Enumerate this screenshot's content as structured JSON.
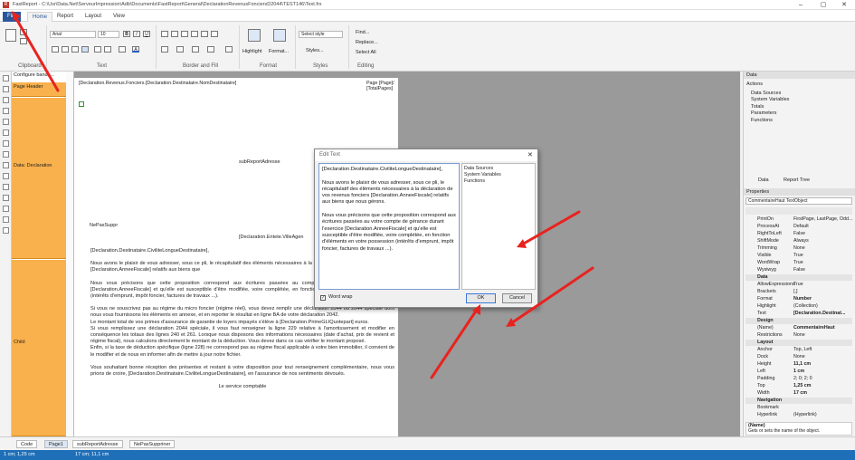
{
  "window": {
    "title": "FastReport - C:\\Usr\\Data.Net\\ServeurImpression\\Adb\\Documents\\FastReport\\General\\DeclarationRevenusFonciersD2044\\TEST146\\Text.frx"
  },
  "menu": {
    "file": "File",
    "home": "Home",
    "report": "Report",
    "layout": "Layout",
    "view": "View"
  },
  "ribbon": {
    "font_name": "Arial",
    "font_size": "10",
    "style_value": "Select style",
    "groups": {
      "clipboard": "Clipboard",
      "text": "Text",
      "border": "Border and Fill",
      "format": "Format",
      "styles": "Styles",
      "editing": "Editing"
    },
    "highlight": "Highlight",
    "format_btn": "Format...",
    "styles_btn": "Styles...",
    "find": "Find...",
    "replace": "Replace...",
    "select_all": "Select All"
  },
  "tools": {
    "configure_bands": "Configure bands..."
  },
  "bands": {
    "page_header": "Page Header",
    "data": "Data: Declaration",
    "child": "Child"
  },
  "page": {
    "header_field": "[Declaration.Revenus.Fonciers.[Declaration.Destinataire.NomDestinataire]",
    "page_field": "Page [Page]/\n[TotalPages]",
    "subreport": "subReportAdresse",
    "entete": "[Declaration.Entete.VilleAgen",
    "nepas": "NePasSuppr",
    "para1": "[Declaration.Destinataire.CiviliteLongueDestinataire],",
    "para2": "Nous avons le plaisir de vous adresser, sous ce pli, le récapitulatif des éléments nécessaires à la déclaration de vos revenus fonciers [Declaration.AnneeFiscale] relatifs aux biens que",
    "para3": "Nous vous précisons que cette proposition correspond aux écritures passées au compte de gérance durant l'exercice [Declaration.AnneeFiscale] et qu'elle est susceptible d'être modifiée, voire complétée, en fonction d'éléments en votre possession (intérêts d'emprunt, impôt foncier, factures de travaux ...).",
    "para4": "Si vous ne souscrivez pas au régime du micro foncier (régime réel), vous devez remplir une déclaration 2044 ou 2044 spéciale dont nous vous fournissons les éléments en annexe, et en reporter le résultat en ligne BA de votre déclaration 2042.",
    "para5": "Le montant total de vos primes d'assurance de garantie de loyers impayés s'élève à [Declaration.PrimeGLIQuotepart] euros.",
    "para6": "Si vous remplissez une déclaration 2044 spéciale, il vous faut renseigner la ligne 229 relative à l'amortissement et modifier en conséquence les totaux des lignes 240 et 261. Lorsque nous disposons des informations nécessaires (date d'achat, prix de revient et régime fiscal), nous calculons directement le montant de la déduction. Vous devez dans ce cas vérifier le montant proposé.",
    "para7": "Enfin, si la taxe de déduction spécifique (ligne 228) ne correspond pas au régime fiscal applicable à votre bien immobilier, il convient de le modifier et de nous en informer afin de mettre à jour notre fichier.",
    "para8": "Vous souhaitant bonne réception des présentes et restant à votre disposition pour tout renseignement complémentaire, nous vous prions de croire, [Declaration.Destinataire.CiviliteLongueDestinataire], en l'assurance de nos sentiments dévoués.",
    "para9": "Le service comptable"
  },
  "dialog": {
    "title": "Edit Text",
    "text": "[Declaration.Destinataire.CiviliteLongueDestinataire],\n\nNous avons le plaisir de vous adresser, sous ce pli, le récapitulatif des éléments nécessaires à la déclaration de vos revenus fonciers [Declaration.AnneeFiscale] relatifs aux biens que nous gérons.\n\nNous vous précisons que cette proposition correspond aux écritures passées au votre compte de gérance durant l'exercice [Declaration.AnneeFiscale] et qu'elle est susceptible d'être modifiée, voire complétée, en fonction d'éléments en votre possession (intérêts d'emprunt, impôt foncier, factures de travaux ...).",
    "tree": [
      "Data Sources",
      "System Variables",
      "Functions"
    ],
    "word_wrap": "Word wrap",
    "ok": "OK",
    "cancel": "Cancel"
  },
  "right": {
    "data_header": "Data",
    "actions": "Actions",
    "tree": [
      "Data Sources",
      "System Variables",
      "Totals",
      "Parameters",
      "Functions"
    ],
    "tab_data": "Data",
    "tab_tree": "Report Tree",
    "properties_header": "Properties",
    "object": "CommentaireHaut  TextObject",
    "props": [
      {
        "k": "PrintOn",
        "v": "FirstPage, LastPage, Odd..."
      },
      {
        "k": "ProcessAt",
        "v": "Default"
      },
      {
        "k": "RightToLeft",
        "v": "False"
      },
      {
        "k": "ShiftMode",
        "v": "Always"
      },
      {
        "k": "Trimming",
        "v": "None"
      },
      {
        "k": "Visible",
        "v": "True"
      },
      {
        "k": "WordWrap",
        "v": "True"
      },
      {
        "k": "Wysiwyg",
        "v": "False"
      }
    ],
    "cat_data": "Data",
    "props_data": [
      {
        "k": "AllowExpressions",
        "v": "True"
      },
      {
        "k": "Brackets",
        "v": "[,]"
      },
      {
        "k": "Format",
        "v": "Number"
      },
      {
        "k": "Highlight",
        "v": "(Collection)"
      },
      {
        "k": "Text",
        "v": "[Declaration.Destinat..."
      }
    ],
    "cat_design": "Design",
    "props_design": [
      {
        "k": "(Name)",
        "v": "CommentaireHaut"
      },
      {
        "k": "Restrictions",
        "v": "None"
      }
    ],
    "cat_layout": "Layout",
    "props_layout": [
      {
        "k": "Anchor",
        "v": "Top, Left"
      },
      {
        "k": "Dock",
        "v": "None"
      },
      {
        "k": "Height",
        "v": "11,1 cm"
      },
      {
        "k": "Left",
        "v": "1 cm"
      },
      {
        "k": "Padding",
        "v": "2; 0; 2; 0"
      },
      {
        "k": "Top",
        "v": "1,25 cm"
      },
      {
        "k": "Width",
        "v": "17 cm"
      }
    ],
    "cat_nav": "Navigation",
    "props_nav": [
      {
        "k": "Bookmark",
        "v": ""
      },
      {
        "k": "Hyperlink",
        "v": "(Hyperlink)"
      }
    ],
    "desc_title": "(Name)",
    "desc_text": "Gets or sets the name of the object."
  },
  "tabs": [
    "Code",
    "Page1",
    "subReportAdresse",
    "NePasSuppriner"
  ],
  "status": {
    "pos": "1 cm; 1,25 cm",
    "size": "17 cm; 11,1 cm"
  },
  "colors": {
    "accent": "#2b579a",
    "band": "#f9b14d",
    "status": "#1f6fb8",
    "arrow": "#e8231f"
  }
}
